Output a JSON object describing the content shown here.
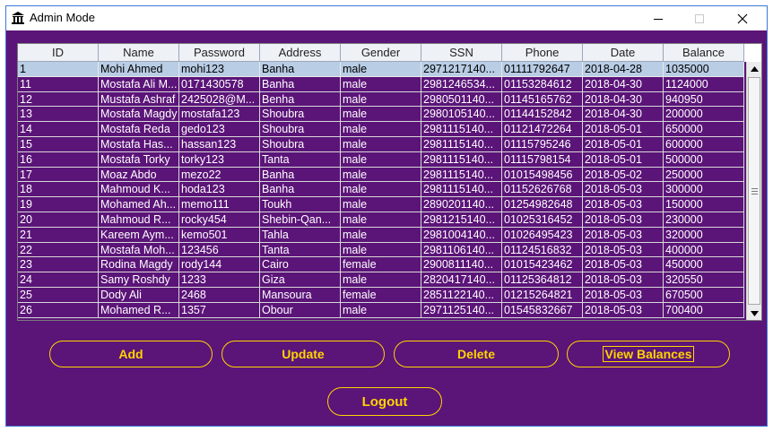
{
  "window": {
    "title": "Admin Mode",
    "icon": "bank-icon",
    "controls": {
      "minimize": "minimize-icon",
      "maximize": "maximize-icon",
      "close": "close-icon"
    }
  },
  "colors": {
    "background": "#5b1478",
    "accent": "#ffd400",
    "selection": "#b9cde5"
  },
  "table": {
    "columns": [
      "ID",
      "Name",
      "Password",
      "Address",
      "Gender",
      "SSN",
      "Phone",
      "Date",
      "Balance"
    ],
    "selected_row": 0,
    "rows": [
      [
        "1",
        "Mohi Ahmed",
        "mohi123",
        "Banha",
        "male",
        "2971217140...",
        "01111792647",
        "2018-04-28",
        "1035000"
      ],
      [
        "11",
        "Mostafa Ali M...",
        "0171430578",
        "Banha",
        "male",
        "2981246534...",
        "01153284612",
        "2018-04-30",
        "1124000"
      ],
      [
        "12",
        "Mustafa Ashraf",
        "2425028@M...",
        "Benha",
        "male",
        "2980501140...",
        "01145165762",
        "2018-04-30",
        "940950"
      ],
      [
        "13",
        "Mostafa Magdy",
        "mostafa123",
        "Shoubra",
        "male",
        "2980105140...",
        "01144152842",
        "2018-04-30",
        "200000"
      ],
      [
        "14",
        "Mostafa Reda",
        "gedo123",
        "Shoubra",
        "male",
        "2981115140...",
        "01121472264",
        "2018-05-01",
        "650000"
      ],
      [
        "15",
        "Mostafa Has...",
        "hassan123",
        "Shoubra",
        "male",
        "2981115140...",
        "01115795246",
        "2018-05-01",
        "600000"
      ],
      [
        "16",
        "Mostafa Torky",
        "torky123",
        "Tanta",
        "male",
        "2981115140...",
        "01115798154",
        "2018-05-01",
        "500000"
      ],
      [
        "17",
        "Moaz Abdo",
        "mezo22",
        "Banha",
        "male",
        "2981115140...",
        "01015498456",
        "2018-05-02",
        "250000"
      ],
      [
        "18",
        "Mahmoud K...",
        "hoda123",
        "Banha",
        "male",
        "2981115140...",
        "01152626768",
        "2018-05-03",
        "300000"
      ],
      [
        "19",
        "Mohamed Ah...",
        "memo111",
        "Toukh",
        "male",
        "2890201140...",
        "01254982648",
        "2018-05-03",
        "150000"
      ],
      [
        "20",
        "Mahmoud R...",
        "rocky454",
        "Shebin-Qan...",
        "male",
        "2981215140...",
        "01025316452",
        "2018-05-03",
        "230000"
      ],
      [
        "21",
        "Kareem Aym...",
        "kemo501",
        "Tahla",
        "male",
        "2981004140...",
        "01026495423",
        "2018-05-03",
        "320000"
      ],
      [
        "22",
        "Mostafa Moh...",
        "123456",
        "Tanta",
        "male",
        "2981106140...",
        "01124516832",
        "2018-05-03",
        "400000"
      ],
      [
        "23",
        "Rodina Magdy",
        "rody144",
        "Cairo",
        "female",
        "2900811140...",
        "01015423462",
        "2018-05-03",
        "450000"
      ],
      [
        "24",
        "Samy Roshdy",
        "1233",
        "Giza",
        "male",
        "2820417140...",
        "01125364812",
        "2018-05-03",
        "320550"
      ],
      [
        "25",
        "Dody Ali",
        "2468",
        "Mansoura",
        "female",
        "2851122140...",
        "01215264821",
        "2018-05-03",
        "670500"
      ],
      [
        "26",
        "Mohamed R...",
        "1357",
        "Obour",
        "male",
        "2971125140...",
        "01545832667",
        "2018-05-03",
        "700400"
      ]
    ]
  },
  "scrollbar": {
    "up": "arrow-up-icon",
    "down": "arrow-down-icon"
  },
  "buttons": {
    "add": "Add",
    "update": "Update",
    "delete": "Delete",
    "view_balances": "View Balances",
    "logout": "Logout"
  }
}
